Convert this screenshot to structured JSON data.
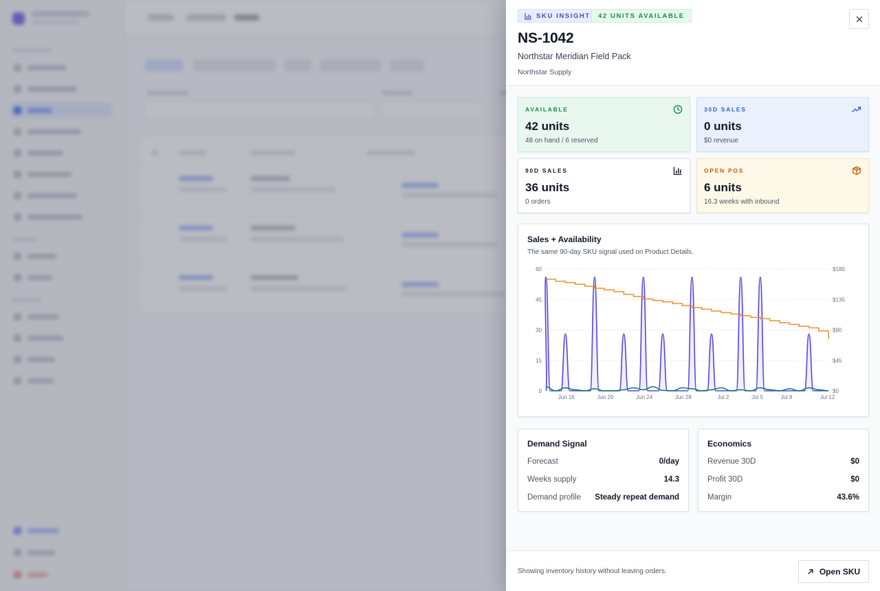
{
  "drawer": {
    "badge_insight": "SKU INSIGHT",
    "badge_units": "42 UNITS AVAILABLE",
    "sku": "NS-1042",
    "product_name": "Northstar Meridian Field Pack",
    "supplier": "Northstar Supply",
    "close_icon": "close-icon"
  },
  "stats": [
    {
      "label": "AVAILABLE",
      "value": "42 units",
      "sub": "48 on hand / 6 reserved",
      "icon": "clock-icon",
      "color": "#178a4a"
    },
    {
      "label": "30D SALES",
      "value": "0 units",
      "sub": "$0 revenue",
      "icon": "trend-up-icon",
      "color": "#2f5fd0"
    },
    {
      "label": "90D SALES",
      "value": "36 units",
      "sub": "0 orders",
      "icon": "bar-chart-icon",
      "color": "#111827"
    },
    {
      "label": "OPEN POS",
      "value": "6 units",
      "sub": "16.3 weeks with inbound",
      "icon": "package-icon",
      "color": "#c4600e"
    }
  ],
  "chart": {
    "title": "Sales + Availability",
    "subtitle": "The same 90-day SKU signal used on Product Details."
  },
  "chart_data": {
    "type": "line",
    "left_axis": {
      "ticks": [
        "0",
        "15",
        "30",
        "45",
        "60"
      ],
      "range": [
        0,
        60
      ]
    },
    "right_axis": {
      "ticks": [
        "$0",
        "$45",
        "$90",
        "$135",
        "$180"
      ],
      "range": [
        0,
        180
      ]
    },
    "x_ticks": [
      "Jun 16",
      "Jun 20",
      "Jun 24",
      "Jun 28",
      "Jul 2",
      "Jul 5",
      "Jul 8",
      "Jul 12"
    ],
    "x_range": [
      0,
      29
    ],
    "x_tick_positions": [
      2.1,
      6.1,
      10.1,
      14.1,
      18.2,
      21.7,
      24.7,
      28.9
    ],
    "series": [
      {
        "key": "sales",
        "color": "#4f46e5",
        "fill": "#ebe9fe",
        "spikes": [
          {
            "x": 0,
            "y": 56
          },
          {
            "x": 2,
            "y": 28
          },
          {
            "x": 5,
            "y": 56
          },
          {
            "x": 8,
            "y": 28
          },
          {
            "x": 10,
            "y": 56
          },
          {
            "x": 12,
            "y": 28
          },
          {
            "x": 15,
            "y": 56
          },
          {
            "x": 17,
            "y": 28
          },
          {
            "x": 20,
            "y": 56
          },
          {
            "x": 22,
            "y": 56
          },
          {
            "x": 27,
            "y": 28
          }
        ]
      },
      {
        "key": "availability",
        "color": "#e8912d",
        "points": [
          [
            0,
            55
          ],
          [
            1,
            54
          ],
          [
            2,
            53.3
          ],
          [
            3,
            52.5
          ],
          [
            4,
            51.5
          ],
          [
            5,
            50.5
          ],
          [
            6,
            49.7
          ],
          [
            7,
            48.8
          ],
          [
            8,
            47.5
          ],
          [
            9,
            46.5
          ],
          [
            10,
            45.3
          ],
          [
            11,
            44.5
          ],
          [
            12,
            43.8
          ],
          [
            13,
            43
          ],
          [
            14,
            42
          ],
          [
            15,
            41
          ],
          [
            16,
            40.2
          ],
          [
            17,
            39.3
          ],
          [
            18,
            38.5
          ],
          [
            19,
            37.8
          ],
          [
            20,
            37
          ],
          [
            21,
            36.2
          ],
          [
            22,
            35.5
          ],
          [
            23,
            34.5
          ],
          [
            24,
            33.5
          ],
          [
            25,
            32.7
          ],
          [
            26,
            31.8
          ],
          [
            27,
            31
          ],
          [
            28,
            29.5
          ],
          [
            29,
            25.5
          ]
        ]
      },
      {
        "key": "receipts",
        "color": "#0f766e",
        "points": [
          [
            0,
            2
          ],
          [
            1,
            0
          ],
          [
            2,
            1.5
          ],
          [
            3,
            0.5
          ],
          [
            4,
            0
          ],
          [
            5,
            1
          ],
          [
            6,
            0
          ],
          [
            7,
            0
          ],
          [
            8,
            0.5
          ],
          [
            9,
            1.5
          ],
          [
            10,
            0.5
          ],
          [
            11,
            2
          ],
          [
            12,
            0.2
          ],
          [
            13,
            0
          ],
          [
            14,
            1.5
          ],
          [
            15,
            1
          ],
          [
            16,
            0
          ],
          [
            17,
            0.5
          ],
          [
            18,
            1.5
          ],
          [
            19,
            0
          ],
          [
            20,
            0.5
          ],
          [
            21,
            0
          ],
          [
            22,
            1.5
          ],
          [
            23,
            0.5
          ],
          [
            24,
            0
          ],
          [
            25,
            1
          ],
          [
            26,
            0
          ],
          [
            27,
            1.5
          ],
          [
            28,
            0.5
          ],
          [
            29,
            0
          ]
        ]
      }
    ]
  },
  "demand": {
    "title": "Demand Signal",
    "rows": [
      {
        "k": "Forecast",
        "v": "0/day"
      },
      {
        "k": "Weeks supply",
        "v": "14.3"
      },
      {
        "k": "Demand profile",
        "v": "Steady repeat demand"
      }
    ]
  },
  "economics": {
    "title": "Economics",
    "rows": [
      {
        "k": "Revenue 30D",
        "v": "$0"
      },
      {
        "k": "Profit 30D",
        "v": "$0"
      },
      {
        "k": "Margin",
        "v": "43.6%"
      }
    ]
  },
  "footer": {
    "note": "Showing inventory history without leaving orders.",
    "open_label": "Open SKU",
    "open_icon": "arrow-up-right-icon"
  }
}
